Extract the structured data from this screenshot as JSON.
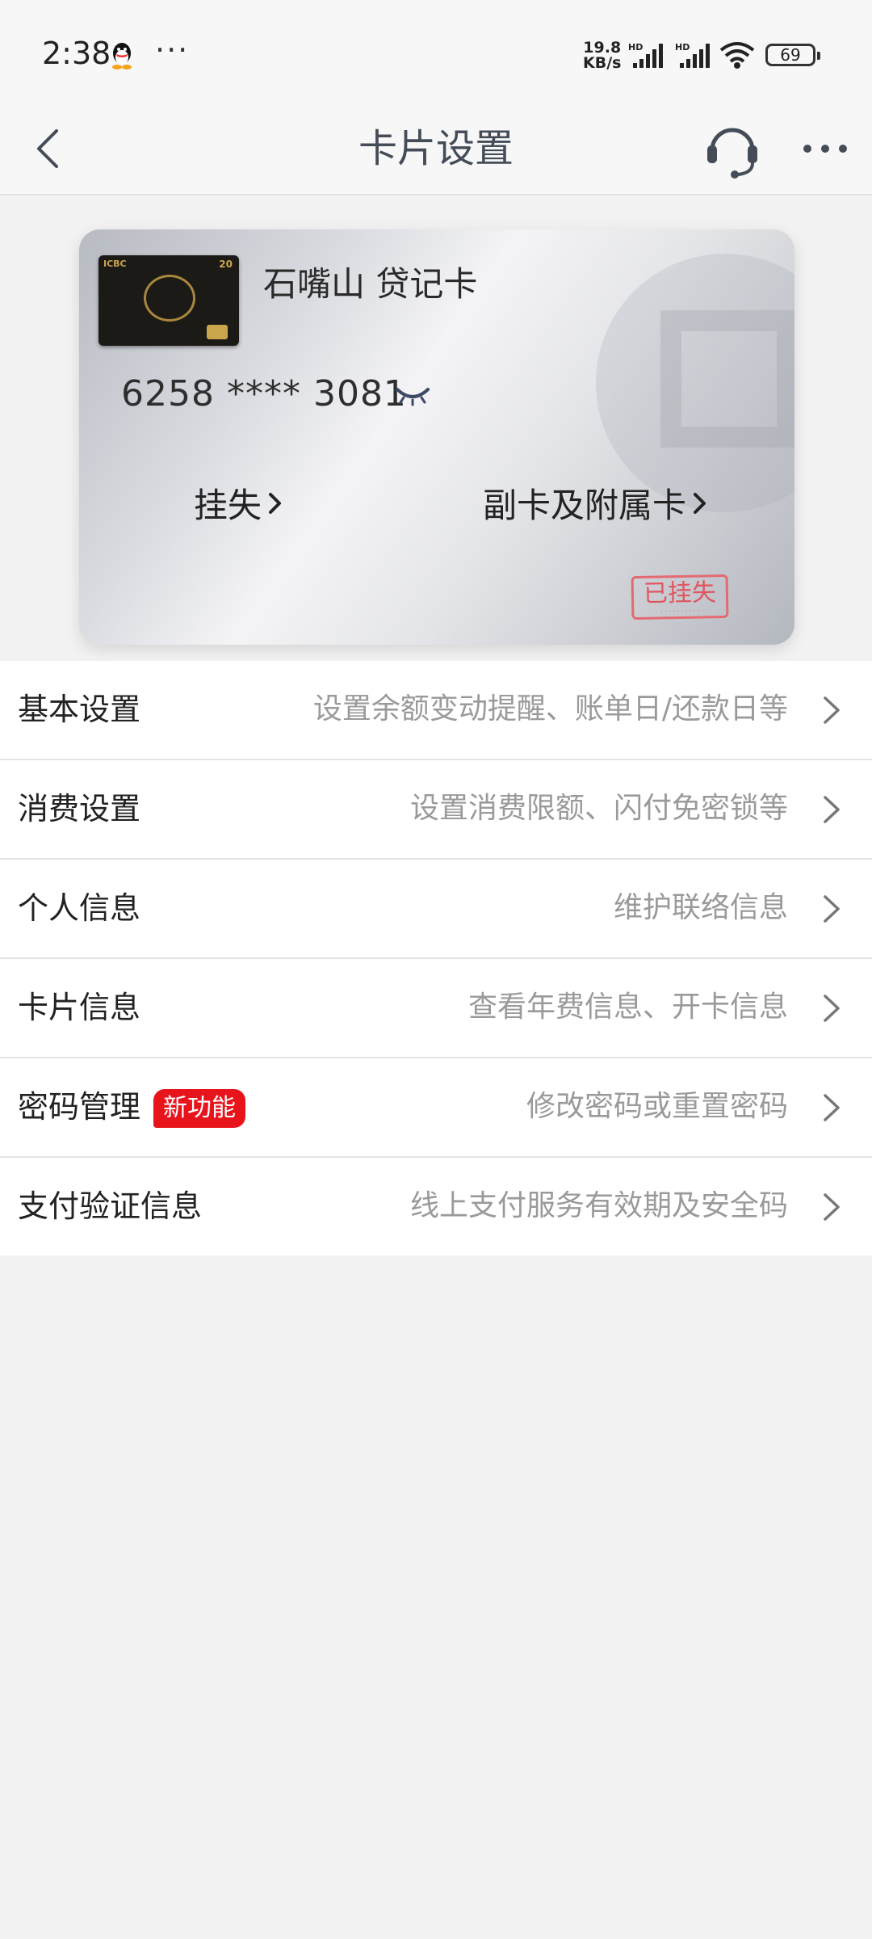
{
  "status_bar": {
    "time": "2:38",
    "dots": "···",
    "speed_value": "19.8",
    "speed_unit": "KB/s",
    "signal_label_1": "HD",
    "signal_label_2": "HD",
    "battery": "69",
    "icons": [
      "qq-icon",
      "signal-icon",
      "wifi-icon",
      "battery-icon"
    ]
  },
  "nav": {
    "title": "卡片设置",
    "icons": [
      "back-icon",
      "customer-service-icon",
      "more-icon"
    ]
  },
  "card": {
    "name": "石嘴山 贷记卡",
    "number": "6258 **** 3081",
    "lost_label": "挂失",
    "sub_card_label": "副卡及附属卡",
    "stamp_text": "已挂失",
    "thumb_brand": "ICBC",
    "thumb_number": "20"
  },
  "settings": [
    {
      "label": "基本设置",
      "desc": "设置余额变动提醒、账单日/还款日等"
    },
    {
      "label": "消费设置",
      "desc": "设置消费限额、闪付免密锁等"
    },
    {
      "label": "个人信息",
      "desc": "维护联络信息"
    },
    {
      "label": "卡片信息",
      "desc": "查看年费信息、开卡信息"
    },
    {
      "label": "密码管理",
      "desc": "修改密码或重置密码",
      "badge": "新功能"
    },
    {
      "label": "支付验证信息",
      "desc": "线上支付服务有效期及安全码"
    }
  ],
  "colors": {
    "background": "#f2f2f2",
    "title": "#444c58",
    "badge": "#e8141c",
    "desc": "#9a9a9a",
    "stamp": "#e0555f"
  }
}
